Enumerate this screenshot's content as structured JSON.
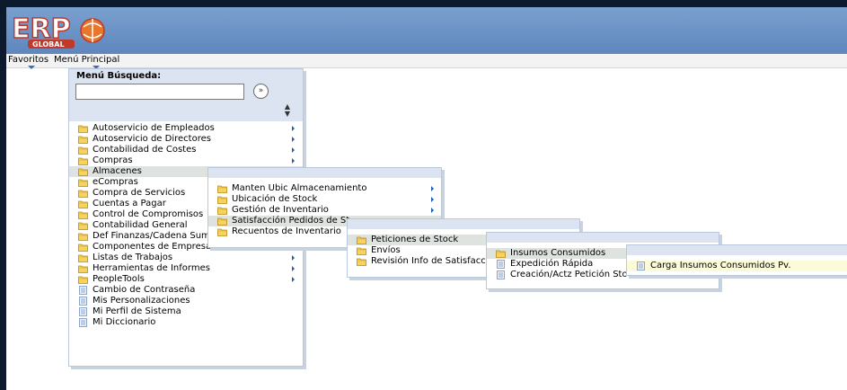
{
  "app": {
    "logo_text": "ERP",
    "logo_sub": "GLOBAL"
  },
  "menubar": {
    "favorites": "Favoritos",
    "main_menu": "Menú Principal"
  },
  "search": {
    "title": "Menú Búsqueda:",
    "value": "",
    "go_glyph": "»"
  },
  "menu": {
    "items": [
      {
        "label": "Autoservicio de Empleados",
        "type": "folder",
        "arrow": true
      },
      {
        "label": "Autoservicio de Directores",
        "type": "folder",
        "arrow": true
      },
      {
        "label": "Contabilidad de Costes",
        "type": "folder",
        "arrow": true
      },
      {
        "label": "Compras",
        "type": "folder",
        "arrow": true
      },
      {
        "label": "Almacenes",
        "type": "folder",
        "arrow": true,
        "selected": true
      },
      {
        "label": "eCompras",
        "type": "folder",
        "arrow": true
      },
      {
        "label": "Compra de Servicios",
        "type": "folder",
        "arrow": true
      },
      {
        "label": "Cuentas a Pagar",
        "type": "folder",
        "arrow": true
      },
      {
        "label": "Control de Compromisos",
        "type": "folder",
        "arrow": true
      },
      {
        "label": "Contabilidad General",
        "type": "folder",
        "arrow": true
      },
      {
        "label": "Def Finanzas/Cadena Suministro",
        "type": "folder",
        "arrow": true
      },
      {
        "label": "Componentes de Empresa",
        "type": "folder",
        "arrow": true
      },
      {
        "label": "Listas de Trabajos",
        "type": "folder",
        "arrow": true
      },
      {
        "label": "Herramientas de Informes",
        "type": "folder",
        "arrow": true
      },
      {
        "label": "PeopleTools",
        "type": "folder",
        "arrow": true
      },
      {
        "label": "Cambio de Contraseña",
        "type": "page",
        "arrow": false
      },
      {
        "label": "Mis Personalizaciones",
        "type": "page",
        "arrow": false
      },
      {
        "label": "Mi Perfil de Sistema",
        "type": "page",
        "arrow": false
      },
      {
        "label": "Mi Diccionario",
        "type": "page",
        "arrow": false
      }
    ]
  },
  "submenu1": {
    "items": [
      {
        "label": "Manten Ubic Almacenamiento",
        "type": "folder",
        "arrow": true
      },
      {
        "label": "Ubicación de Stock",
        "type": "folder",
        "arrow": true
      },
      {
        "label": "Gestión de Inventario",
        "type": "folder",
        "arrow": true
      },
      {
        "label": "Satisfacción Pedidos de St",
        "type": "folder",
        "arrow": true,
        "selected": true
      },
      {
        "label": "Recuentos de Inventario",
        "type": "folder",
        "arrow": true
      }
    ]
  },
  "submenu2": {
    "items": [
      {
        "label": "Peticiones de Stock",
        "type": "folder",
        "arrow": true,
        "selected": true
      },
      {
        "label": "Envíos",
        "type": "folder",
        "arrow": true
      },
      {
        "label": "Revisión Info de Satisfacci",
        "type": "folder",
        "arrow": true
      }
    ]
  },
  "submenu3": {
    "items": [
      {
        "label": "Insumos Consumidos",
        "type": "folder",
        "arrow": true,
        "selected": true
      },
      {
        "label": "Expedición Rápida",
        "type": "page",
        "arrow": false
      },
      {
        "label": "Creación/Actz Petición Stock",
        "type": "page",
        "arrow": false
      }
    ]
  },
  "submenu4": {
    "items": [
      {
        "label": "Carga Insumos Consumidos Pv.",
        "type": "page",
        "arrow": false,
        "selected": true
      }
    ]
  },
  "colors": {
    "header": "#6f94c6",
    "border": "#0d1a2e",
    "selected": "#dfe3df",
    "highlight": "#fbfbd9",
    "arrow": "#1f5fb5"
  }
}
